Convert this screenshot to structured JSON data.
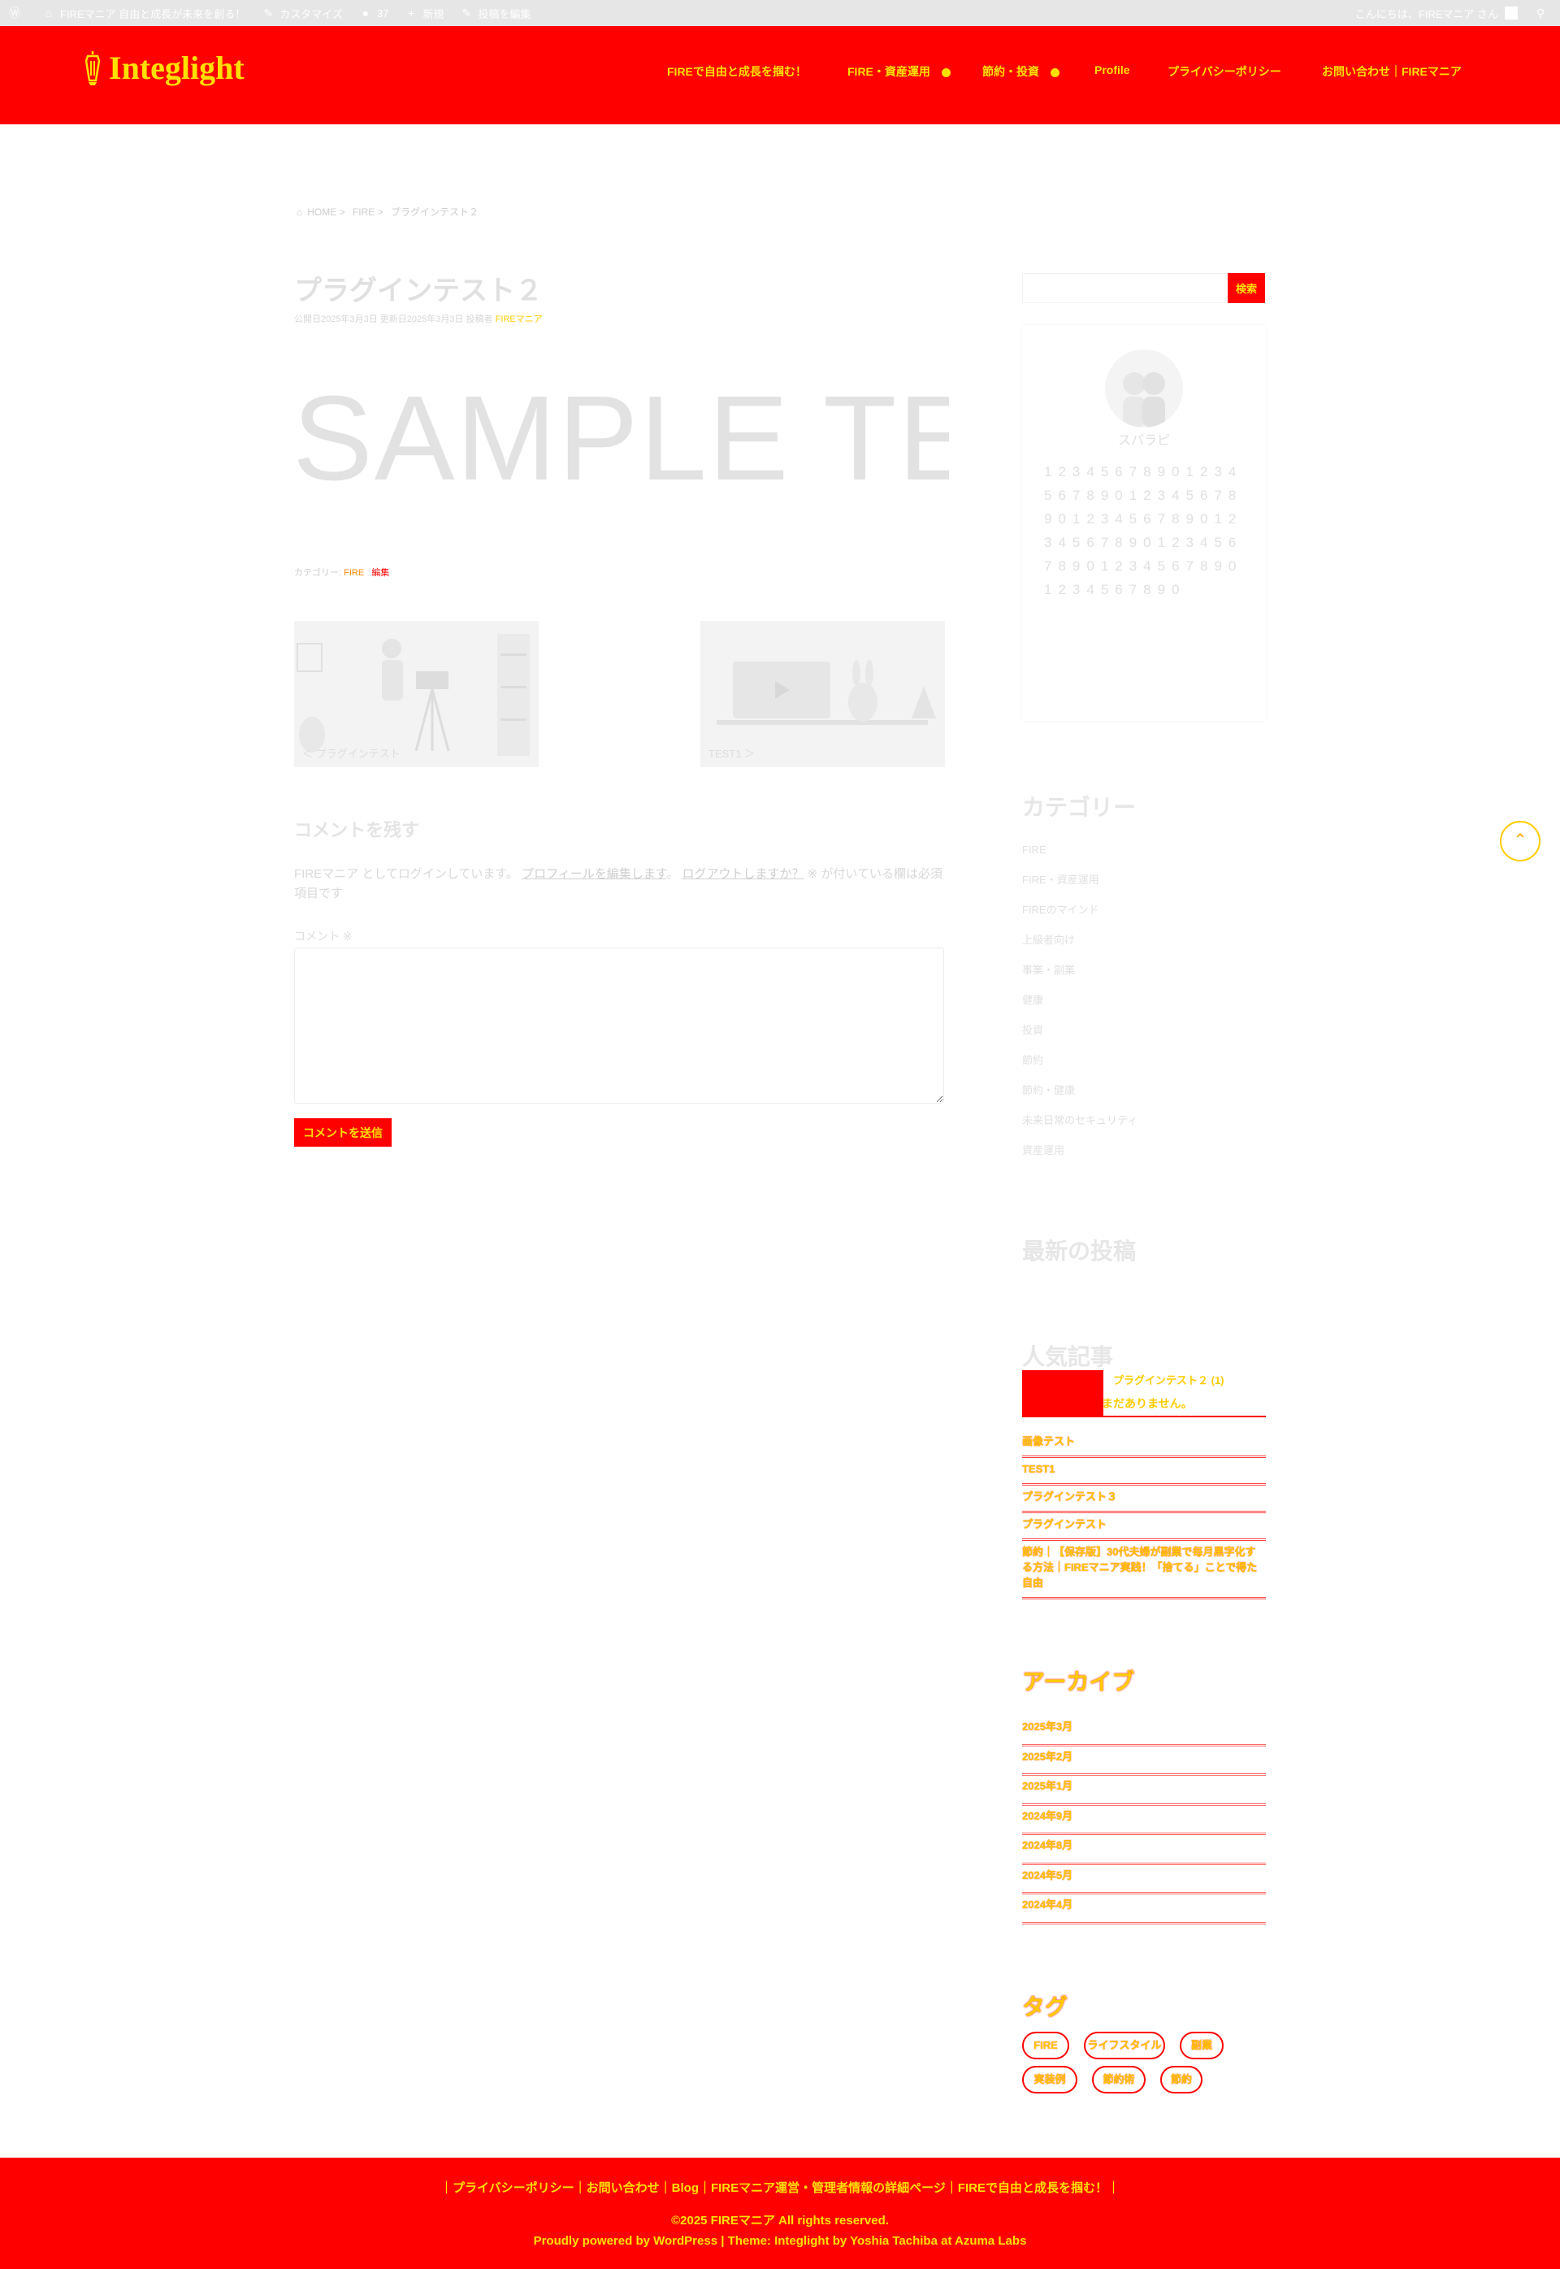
{
  "admin_bar": {
    "site_name": "FIREマニア 自由と成長が未来を創る！",
    "customize": "カスタマイズ",
    "comments_count": "37",
    "new": "新規",
    "edit_post": "投稿を編集",
    "greeting": "こんにちは、FIREマニア さん"
  },
  "header": {
    "logo_text": "Integlight",
    "nav": [
      {
        "label": "FIREで自由と成長を掴む！"
      },
      {
        "label": "FIRE・資産運用"
      },
      {
        "label": "節約・投資"
      },
      {
        "label": "Profile"
      },
      {
        "label": "プライバシーポリシー"
      },
      {
        "label": "お問い合わせ｜FIREマニア"
      }
    ]
  },
  "breadcrumb": {
    "home": "HOME",
    "sep": ">",
    "category": "FIRE",
    "current": "プラグインテスト２"
  },
  "post": {
    "title": "プラグインテスト２",
    "meta": "公開日2025年3月3日 更新日2025年3月3日 投稿者",
    "author": "FIREマニア",
    "sample_text": "SAMPLE TE",
    "footer_prefix": "カテゴリー:",
    "category": "FIRE",
    "edit": "編集"
  },
  "related": [
    {
      "title": "＜ プラグインテスト"
    },
    {
      "title": "TEST1 ＞"
    }
  ],
  "comment_form": {
    "heading": "コメントを残す",
    "logged_in_prefix": "FIREマニア としてログインしています。",
    "edit_profile": "プロフィールを編集します",
    "logout": "ログアウトしますか？",
    "logged_in_suffix": "※ が付いている欄は必須項目です",
    "label": "コメント ※",
    "submit": "コメントを送信"
  },
  "sidebar": {
    "search_button": "検索",
    "profile_name": "スパラピ",
    "profile_text": "12345678901234567890123456789012345678901234567890123456789012345678901234567890",
    "categories_title": "カテゴリー",
    "categories": [
      "FIRE",
      "FIRE・資産運用",
      "FIREのマインド",
      "上級者向け",
      "事業・副業",
      "健康",
      "投資",
      "節約",
      "節約・健康",
      "未来日常のセキュリティ",
      "資産運用"
    ],
    "recent_title": "最新の投稿",
    "popular_title": "人気記事",
    "popular_item": "プラグインテスト２ (1)",
    "popular_note": "まだありません。",
    "red_list": [
      "画像テスト",
      "TEST1",
      "プラグインテスト３",
      "プラグインテスト",
      "節約｜【保存版】30代夫婦が副業で毎月黒字化する方法｜FIREマニア実践！「捨てる」ことで得た自由"
    ],
    "archive_title": "アーカイブ",
    "archives": [
      "2025年3月",
      "2025年2月",
      "2025年1月",
      "2024年9月",
      "2024年8月",
      "2024年5月",
      "2024年4月"
    ],
    "tag_title": "タグ",
    "tags": [
      "FIRE",
      "ライフスタイル",
      "副業",
      "実装例",
      "節約術",
      "節約"
    ]
  },
  "footer": {
    "links": "｜プライバシーポリシー｜お問い合わせ｜Blog｜FIREマニア運営・管理者情報の詳細ページ｜FIREで自由と成長を掴む！｜",
    "copyright": "©2025 FIREマニア All rights reserved.",
    "powered": "Proudly powered by WordPress | Theme: Integlight by Yoshia Tachiba at Azuma Labs"
  },
  "colors": {
    "header_bg": "#ff0000",
    "accent_yellow": "#ffe000",
    "footer_bg": "#ff0000"
  }
}
